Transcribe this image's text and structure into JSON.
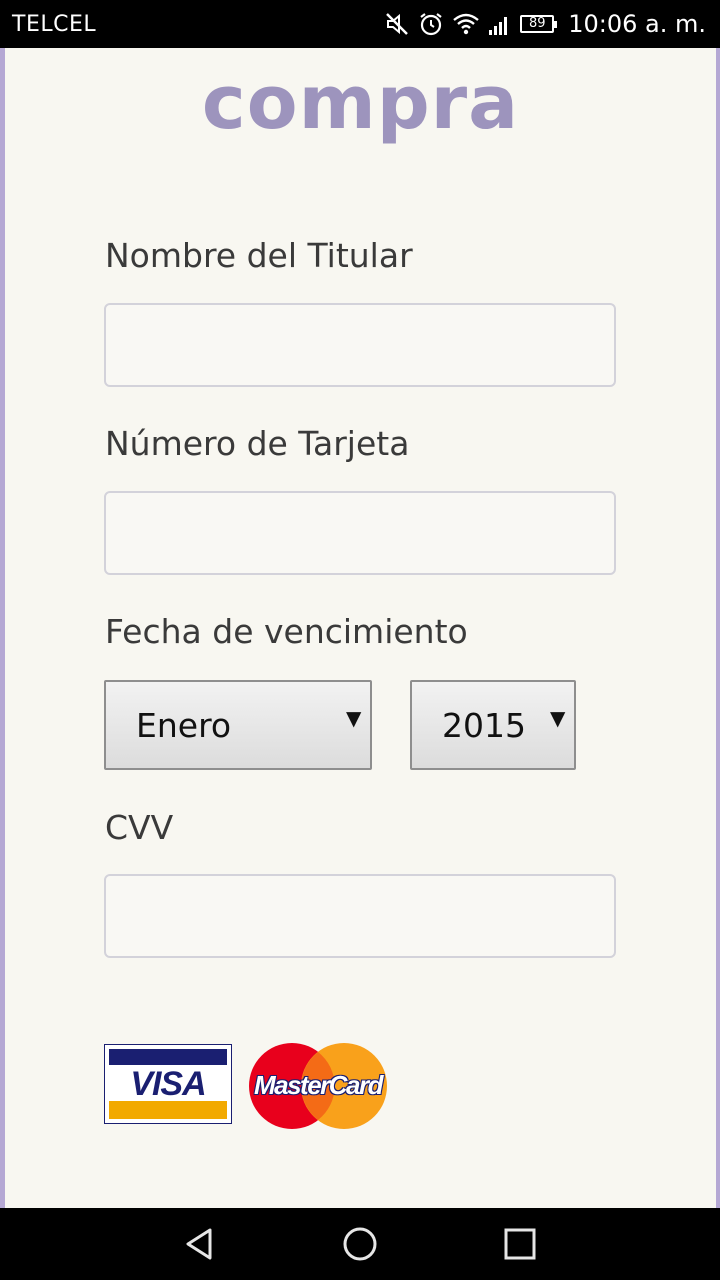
{
  "status_bar": {
    "carrier": "TELCEL",
    "battery_level": "89",
    "time": "10:06 a. m.",
    "icons": [
      "mute-icon",
      "alarm-icon",
      "wifi-icon",
      "signal-icon",
      "battery-icon"
    ]
  },
  "page": {
    "title": "compra"
  },
  "form": {
    "holder_name_label": "Nombre del Titular",
    "holder_name_value": "",
    "card_number_label": "Número de Tarjeta",
    "card_number_value": "",
    "expiry_label": "Fecha de vencimiento",
    "expiry_month": "Enero",
    "expiry_year": "2015",
    "cvv_label": "CVV",
    "cvv_value": ""
  },
  "payment_logos": {
    "visa": "VISA",
    "mastercard": "MasterCard"
  },
  "nav_bar": {
    "buttons": [
      "back-icon",
      "home-icon",
      "recents-icon"
    ]
  },
  "colors": {
    "title": "#9d94bd",
    "border_accent": "#b5a8d4",
    "background": "#f8f7f1"
  }
}
